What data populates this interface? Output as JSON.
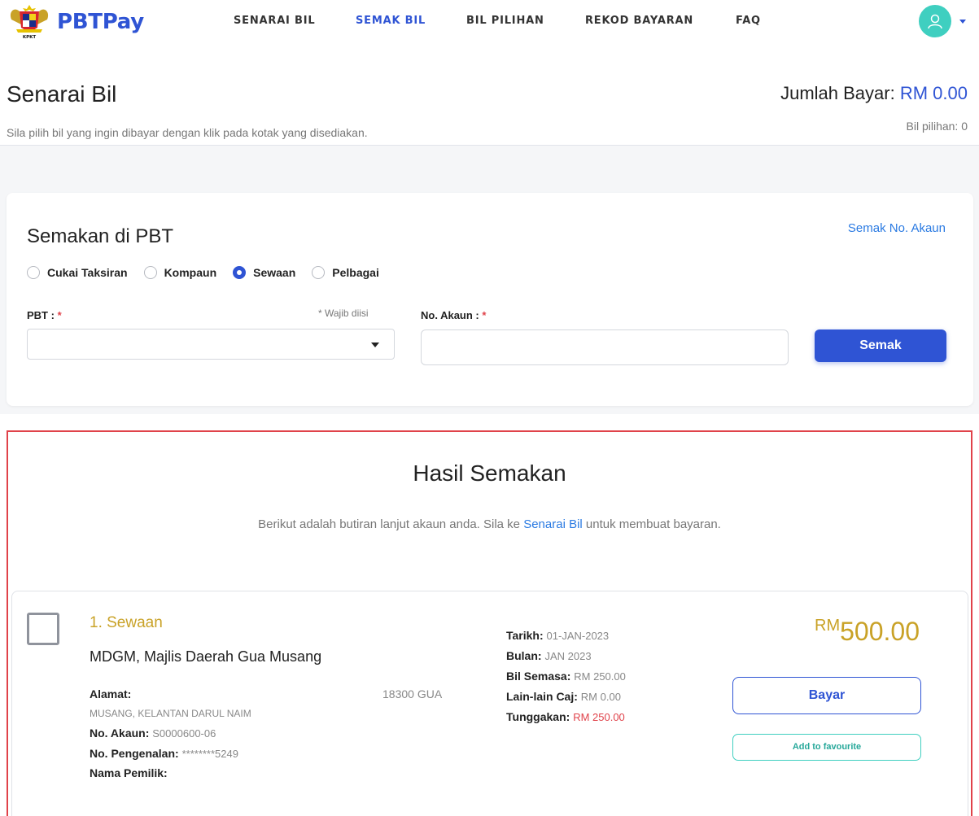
{
  "brand": {
    "name": "PBTPay",
    "crest_label": "KPKT"
  },
  "nav": {
    "items": [
      {
        "label": "SENARAI BIL",
        "active": false
      },
      {
        "label": "SEMAK BIL",
        "active": true
      },
      {
        "label": "BIL PILIHAN",
        "active": false
      },
      {
        "label": "REKOD BAYARAN",
        "active": false
      },
      {
        "label": "FAQ",
        "active": false
      }
    ]
  },
  "header": {
    "title": "Senarai Bil",
    "subtitle": "Sila pilih bil yang ingin dibayar dengan klik pada kotak yang disediakan.",
    "total_label": "Jumlah Bayar:",
    "total_amount": "RM 0.00",
    "selected_count": "Bil pilihan: 0"
  },
  "search": {
    "title": "Semakan di PBT",
    "link": "Semak No. Akaun",
    "options": [
      {
        "label": "Cukai Taksiran",
        "checked": false
      },
      {
        "label": "Kompaun",
        "checked": false
      },
      {
        "label": "Sewaan",
        "checked": true
      },
      {
        "label": "Pelbagai",
        "checked": false
      }
    ],
    "pbt_label": "PBT :",
    "required_mark": "*",
    "required_note": "* Wajib diisi",
    "pbt_value": "",
    "account_label": "No. Akaun :",
    "account_value": "",
    "button": "Semak"
  },
  "results": {
    "title": "Hasil Semakan",
    "desc_before": "Berikut adalah butiran lanjut akaun anda. Sila ke",
    "desc_link": "Senarai Bil",
    "desc_after": "untuk membuat bayaran.",
    "bill": {
      "title": "1. Sewaan",
      "org": "MDGM, Majlis Daerah Gua Musang",
      "address_label": "Alamat:",
      "address_part1": "18300 GUA",
      "address_part2": "MUSANG, KELANTAN DARUL NAIM",
      "account_label": "No. Akaun:",
      "account_value": "S0000600-06",
      "id_label": "No. Pengenalan:",
      "id_value": "********5249",
      "owner_label": "Nama Pemilik:",
      "owner_value": "",
      "date_label": "Tarikh:",
      "date_value": "01-JAN-2023",
      "month_label": "Bulan:",
      "month_value": "JAN 2023",
      "current_label": "Bil Semasa:",
      "current_value": "RM 250.00",
      "other_label": "Lain-lain Caj:",
      "other_value": "RM 0.00",
      "arrears_label": "Tunggakan:",
      "arrears_value": "RM 250.00",
      "amount_currency": "RM",
      "amount_value": "500.00",
      "pay_button": "Bayar",
      "fav_button": "Add to favourite"
    }
  },
  "colors": {
    "primary": "#2f54d4",
    "gold": "#c9a227",
    "teal": "#3fcfc0",
    "red": "#e0424a",
    "link": "#2a7ae2"
  },
  "icons": {
    "crest": "malaysia-crest-icon",
    "avatar": "user-icon",
    "dropdown": "chevron-down-icon"
  }
}
